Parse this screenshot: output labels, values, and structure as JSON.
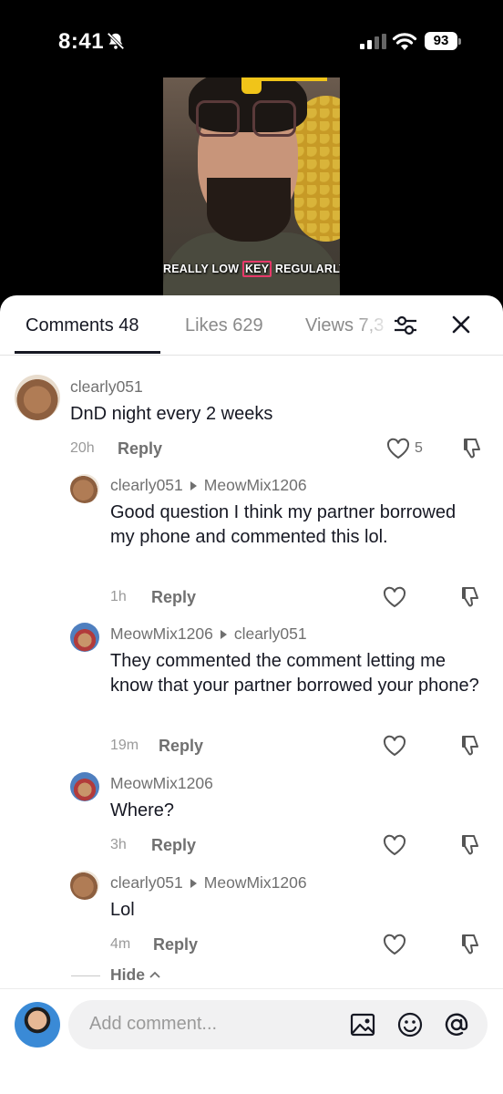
{
  "status_bar": {
    "time": "8:41",
    "battery": "93"
  },
  "video": {
    "caption_pre": "REALLY LOW ",
    "caption_key": "KEY",
    "caption_post": " REGULARLY."
  },
  "tabs": [
    {
      "label": "Comments 48"
    },
    {
      "label": "Likes 629"
    },
    {
      "label": "Views 7,3"
    }
  ],
  "comments": [
    {
      "author": "clearly051",
      "text": "DnD night every 2 weeks",
      "time": "20h",
      "reply": "Reply",
      "likes": "5"
    },
    {
      "author": "clearly051",
      "reply_to": "MeowMix1206",
      "text": "Good question I think my partner borrowed my phone and commented this lol.",
      "time": "1h",
      "reply": "Reply"
    },
    {
      "author": "MeowMix1206",
      "reply_to": "clearly051",
      "text": "They commented the comment letting me know that your partner borrowed your phone?",
      "time": "19m",
      "reply": "Reply"
    },
    {
      "author": "MeowMix1206",
      "text": "Where?",
      "time": "3h",
      "reply": "Reply"
    },
    {
      "author": "clearly051",
      "reply_to": "MeowMix1206",
      "text": "Lol",
      "time": "4m",
      "reply": "Reply"
    }
  ],
  "hide_label": "Hide",
  "composer": {
    "placeholder": "Add comment..."
  },
  "icons": [
    "bell-slash-icon",
    "signal-icon",
    "wifi-icon",
    "battery-icon",
    "filter-icon",
    "close-icon",
    "heart-icon",
    "dislike-icon",
    "chevron-up-icon",
    "image-icon",
    "emoji-icon",
    "mention-icon"
  ]
}
